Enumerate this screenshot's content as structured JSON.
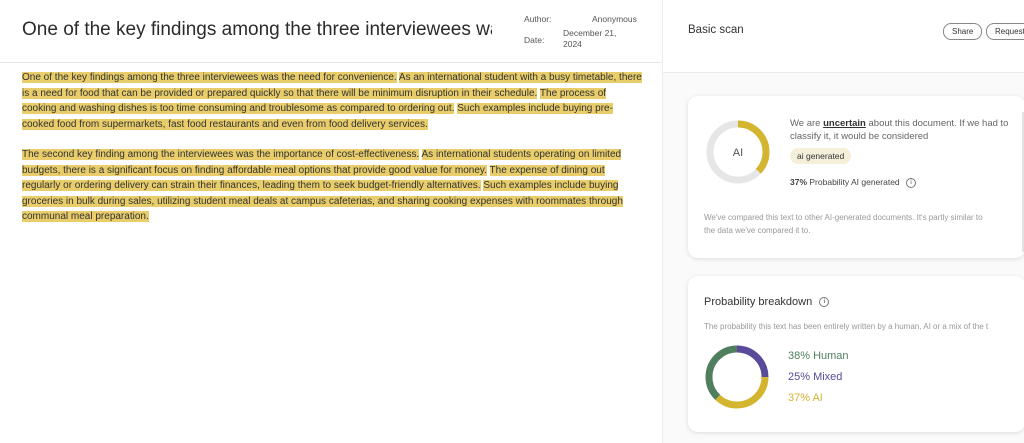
{
  "document": {
    "title": "One of the key findings among the three interviewees was the",
    "author_label": "Author:",
    "author_value": "Anonymous",
    "date_label": "Date:",
    "date_value": "December 21, 2024",
    "paragraphs": [
      [
        {
          "text": "One of the key findings among the three interviewees was the need for convenience.",
          "style": "hl"
        },
        {
          "text": " ",
          "style": ""
        },
        {
          "text": "As an international student with a busy timetable, there is a need for food that can be provided or prepared quickly so that there will be minimum disruption in their schedule.",
          "style": "hl"
        },
        {
          "text": " ",
          "style": ""
        },
        {
          "text": "The process of cooking and washing dishes is too time consuming and troublesome as compared to ordering out.",
          "style": "hl"
        },
        {
          "text": " ",
          "style": ""
        },
        {
          "text": "Such examples include buying pre-cooked food from supermarkets, fast food restaurants and even from food delivery services.",
          "style": "hl"
        }
      ],
      [
        {
          "text": "The second key finding among the interviewees was the importance of cost-effectiveness.",
          "style": "hl"
        },
        {
          "text": " ",
          "style": ""
        },
        {
          "text": "As international students operating on limited budgets, there is a significant focus on finding affordable meal options that provide good value for money.",
          "style": "hl"
        },
        {
          "text": " ",
          "style": ""
        },
        {
          "text": "The expense of dining out regularly or ordering delivery can strain their finances, leading them to seek budget-friendly alternatives.",
          "style": "hl"
        },
        {
          "text": " ",
          "style": ""
        },
        {
          "text": "Such examples include buying groceries in bulk during sales, utilizing student meal deals at campus cafeterias, and sharing cooking expenses with roommates through communal meal preparation.",
          "style": "hl"
        }
      ]
    ]
  },
  "panel": {
    "title": "Basic scan",
    "share_label": "Share",
    "request_label": "Request"
  },
  "result": {
    "ring_label": "AI",
    "ring_fraction": 0.37,
    "ring_color": "#d4b52f",
    "ring_track_color": "#e6e6e6",
    "desc_prefix": "We are ",
    "desc_emphasis": "uncertain",
    "desc_suffix": " about this document. If we had to classify it, it would be considered",
    "tag": "ai generated",
    "prob_value": "37%",
    "prob_text": "Probability AI generated",
    "note": "We've compared this text to other AI-generated documents. It's partly similar to the data we've compared it to."
  },
  "breakdown": {
    "title": "Probability breakdown",
    "note": "The probability this text has been entirely written by a human, AI or a mix of the t",
    "items": [
      {
        "label": "38% Human",
        "value": 38,
        "color": "#4f7f5e"
      },
      {
        "label": "25% Mixed",
        "value": 25,
        "color": "#5a4a9a"
      },
      {
        "label": "37% AI",
        "value": 37,
        "color": "#d4b52f"
      }
    ]
  }
}
